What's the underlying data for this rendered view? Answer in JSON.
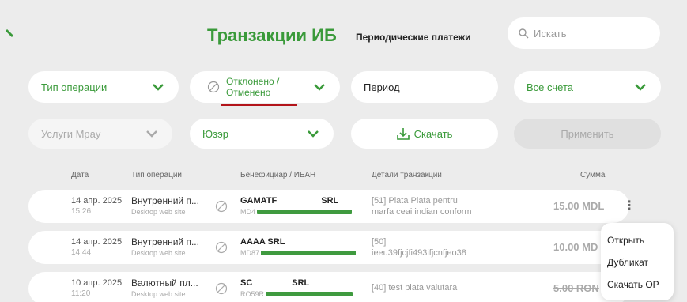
{
  "header": {
    "title": "Транзакции ИБ",
    "periodic_tab": "Периодические платежи",
    "search_placeholder": "Искать"
  },
  "filters": {
    "operation_type": "Тип операции",
    "status": [
      "Отклонено /",
      "Отменено"
    ],
    "period": "Период",
    "accounts": "Все счета",
    "service": "Услуги Mpay",
    "user": "Юзэр",
    "download": "Скачать",
    "apply": "Применить"
  },
  "table": {
    "columns": [
      "Дата",
      "Тип операции",
      "Бенефициар / ИБАН",
      "Детали транзакции",
      "Сумма"
    ],
    "rows": [
      {
        "date": "14 апр. 2025",
        "time": "15:26",
        "op_type": "Внутренний п...",
        "channel": "Desktop web site",
        "beneficiary": "GAMATF",
        "beneficiary_suffix": "SRL",
        "iban_prefix": "MD4",
        "details": [
          "[51] Plata Plata pentru",
          "marfa ceai indian conform"
        ],
        "amount": "15.00 MDL"
      },
      {
        "date": "14 апр. 2025",
        "time": "14:44",
        "op_type": "Внутренний п...",
        "channel": "Desktop web site",
        "beneficiary": "AAAA SRL",
        "beneficiary_suffix": "",
        "iban_prefix": "MD87",
        "details": [
          "[50]",
          "ieeu39fjcjfi493ifjcnfjeo38"
        ],
        "amount": "10.00 MD"
      },
      {
        "date": "10 апр. 2025",
        "time": "11:20",
        "op_type": "Валютный пл...",
        "channel": "Desktop web site",
        "beneficiary": "SC",
        "beneficiary_suffix": "SRL",
        "iban_prefix": "RO59R",
        "details": [
          "[40] test plata valutara"
        ],
        "amount": "5.00 RON"
      }
    ]
  },
  "context_menu": [
    "Открыть",
    "Дубликат",
    "Скачать ОР"
  ],
  "colors": {
    "accent": "#3a9a3a",
    "underline": "#b3141a",
    "background": "#ececec"
  }
}
